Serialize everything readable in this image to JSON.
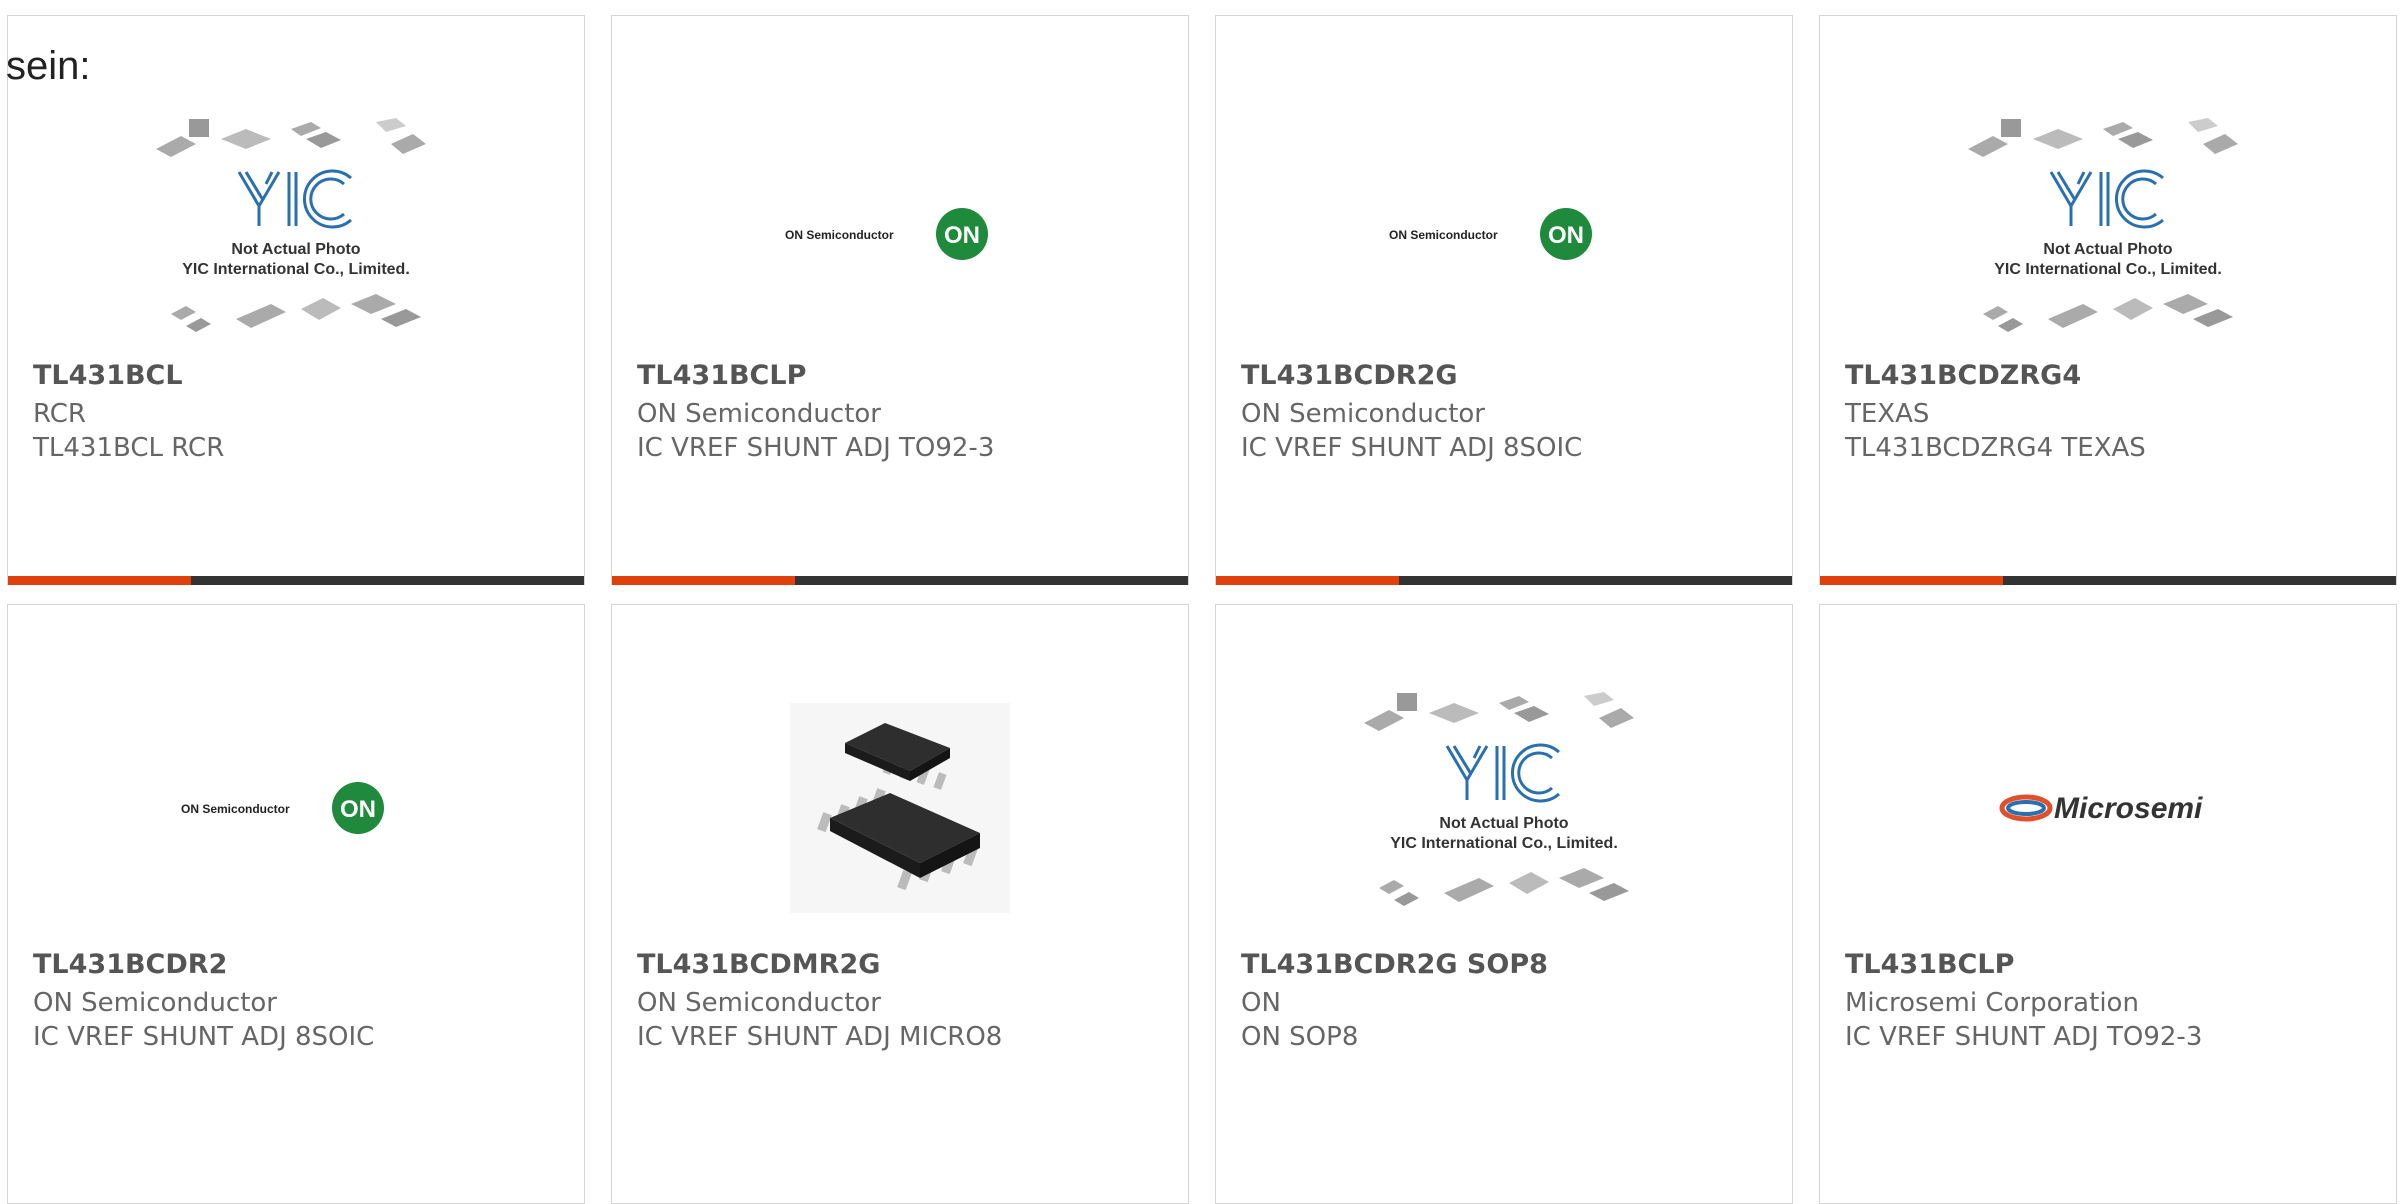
{
  "page": {
    "lead_text": "sein:"
  },
  "images": {
    "yic": {
      "line1": "Not Actual Photo",
      "line2": "YIC International Co., Limited."
    },
    "on_semi": {
      "wordmark": "ON Semiconductor",
      "badge": "ON"
    },
    "microsemi": {
      "wordmark": "Microsemi"
    }
  },
  "colors": {
    "accent": "#e0400c",
    "bar": "#333333",
    "on_green": "#1f8a3c",
    "yic_blue": "#1f6fb3"
  },
  "products": [
    {
      "part": "TL431BCL",
      "maker": "RCR",
      "desc": "TL431BCL RCR",
      "image": "yic-placeholder",
      "accent_bar": true
    },
    {
      "part": "TL431BCLP",
      "maker": "ON Semiconductor",
      "desc": "IC VREF SHUNT ADJ TO92-3",
      "image": "on-semiconductor-logo",
      "accent_bar": true
    },
    {
      "part": "TL431BCDR2G",
      "maker": "ON Semiconductor",
      "desc": "IC VREF SHUNT ADJ 8SOIC",
      "image": "on-semiconductor-logo",
      "accent_bar": true
    },
    {
      "part": "TL431BCDZRG4",
      "maker": "TEXAS",
      "desc": "TL431BCDZRG4 TEXAS",
      "image": "yic-placeholder",
      "accent_bar": true
    },
    {
      "part": "TL431BCDR2",
      "maker": "ON Semiconductor",
      "desc": "IC VREF SHUNT ADJ 8SOIC",
      "image": "on-semiconductor-logo",
      "accent_bar": false
    },
    {
      "part": "TL431BCDMR2G",
      "maker": "ON Semiconductor",
      "desc": "IC VREF SHUNT ADJ MICRO8",
      "image": "micro8-chip-photo",
      "accent_bar": false
    },
    {
      "part": "TL431BCDR2G SOP8",
      "maker": "ON",
      "desc": "ON SOP8",
      "image": "yic-placeholder",
      "accent_bar": false
    },
    {
      "part": "TL431BCLP",
      "maker": "Microsemi Corporation",
      "desc": "IC VREF SHUNT ADJ TO92-3",
      "image": "microsemi-logo",
      "accent_bar": false
    }
  ]
}
